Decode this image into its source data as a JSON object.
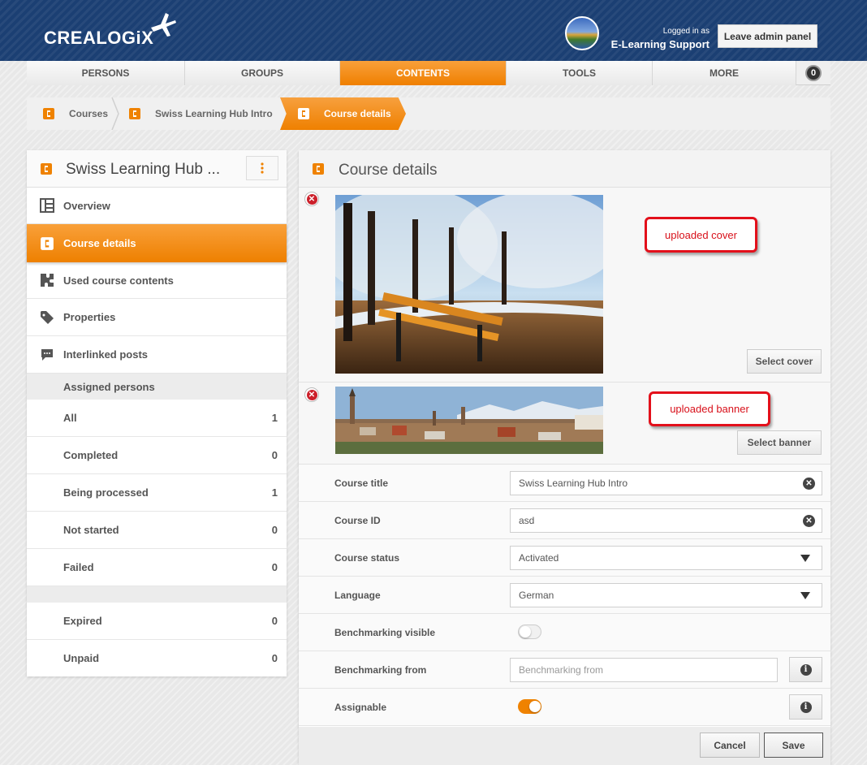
{
  "header": {
    "logo_text": "CREALOGiX",
    "logged_in_label": "Logged in as",
    "user_name": "E-Learning Support",
    "leave_button": "Leave admin panel"
  },
  "nav": {
    "items": [
      {
        "label": "PERSONS"
      },
      {
        "label": "GROUPS"
      },
      {
        "label": "CONTENTS"
      },
      {
        "label": "TOOLS"
      },
      {
        "label": "MORE"
      }
    ],
    "badge": "0"
  },
  "breadcrumb": [
    {
      "label": "Courses"
    },
    {
      "label": "Swiss Learning Hub Intro"
    },
    {
      "label": "Course details"
    }
  ],
  "sidebar": {
    "title": "Swiss Learning Hub ...",
    "items": [
      {
        "label": "Overview",
        "icon": "grid-icon"
      },
      {
        "label": "Course details",
        "icon": "course-icon"
      },
      {
        "label": "Used course contents",
        "icon": "puzzle-icon"
      },
      {
        "label": "Properties",
        "icon": "tag-icon"
      },
      {
        "label": "Interlinked posts",
        "icon": "comment-icon"
      }
    ],
    "assigned_header": "Assigned persons",
    "assigned": [
      {
        "label": "All",
        "count": "1"
      },
      {
        "label": "Completed",
        "count": "0"
      },
      {
        "label": "Being processed",
        "count": "1"
      },
      {
        "label": "Not started",
        "count": "0"
      },
      {
        "label": "Failed",
        "count": "0"
      }
    ],
    "other": [
      {
        "label": "Expired",
        "count": "0"
      },
      {
        "label": "Unpaid",
        "count": "0"
      }
    ]
  },
  "main": {
    "title": "Course details",
    "cover": {
      "annotation": "uploaded cover",
      "button": "Select cover"
    },
    "banner": {
      "annotation": "uploaded banner",
      "button": "Select banner"
    },
    "fields": {
      "course_title": {
        "label": "Course title",
        "value": "Swiss Learning Hub Intro"
      },
      "course_id": {
        "label": "Course ID",
        "value": "asd"
      },
      "course_status": {
        "label": "Course status",
        "value": "Activated"
      },
      "language": {
        "label": "Language",
        "value": "German"
      },
      "benchmarking_visible": {
        "label": "Benchmarking visible",
        "on": false
      },
      "benchmarking_from": {
        "label": "Benchmarking from",
        "placeholder": "Benchmarking from"
      },
      "assignable": {
        "label": "Assignable",
        "on": true
      }
    },
    "cancel_button": "Cancel",
    "save_button": "Save"
  },
  "colors": {
    "accent": "#ef8200",
    "header": "#1b3f73",
    "delete": "#cc1f2a",
    "annotation": "#e3101b"
  }
}
